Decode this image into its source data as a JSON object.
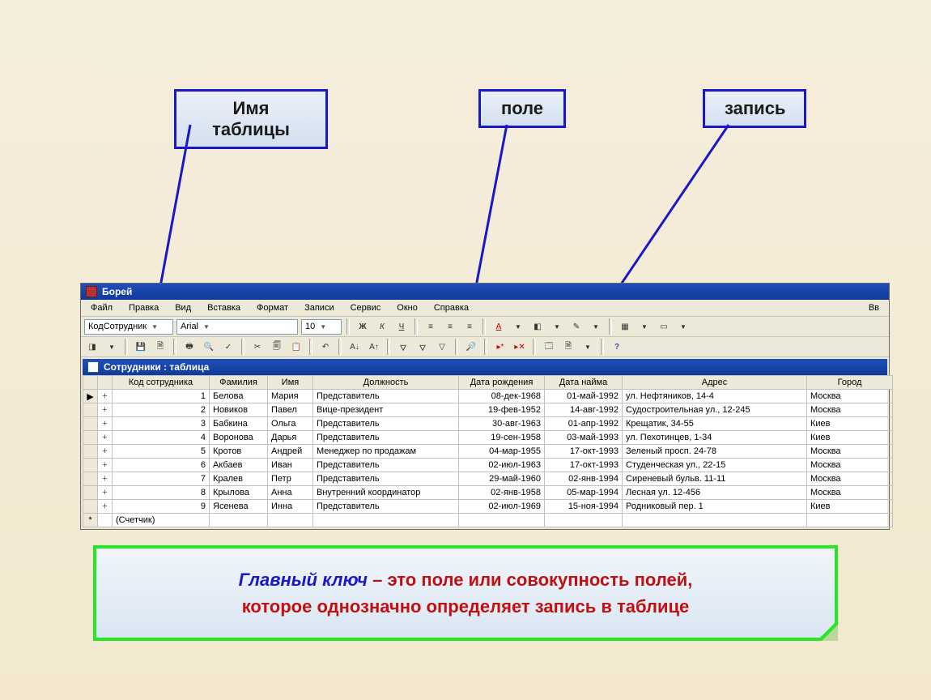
{
  "annotations": {
    "table_name": "Имя таблицы",
    "field": "поле",
    "record": "запись"
  },
  "app": {
    "title": "Борей",
    "menu": [
      "Файл",
      "Правка",
      "Вид",
      "Вставка",
      "Формат",
      "Записи",
      "Сервис",
      "Окно",
      "Справка"
    ],
    "menu_right": "Вв",
    "font_field": "КодСотрудник",
    "font_name": "Arial",
    "font_size": "10",
    "sub_title": "Сотрудники : таблица"
  },
  "toolbar2": {
    "bold": "Ж",
    "italic": "К",
    "underline": "Ч"
  },
  "columns": [
    "Код сотрудника",
    "Фамилия",
    "Имя",
    "Должность",
    "Дата рождения",
    "Дата найма",
    "Адрес",
    "Город"
  ],
  "rows": [
    {
      "id": "1",
      "fam": "Белова",
      "name": "Мария",
      "role": "Представитель",
      "dob": "08-дек-1968",
      "hire": "01-май-1992",
      "addr": "ул. Нефтяников, 14-4",
      "city": "Москва",
      "sel": "▶"
    },
    {
      "id": "2",
      "fam": "Новиков",
      "name": "Павел",
      "role": "Вице-президент",
      "dob": "19-фев-1952",
      "hire": "14-авг-1992",
      "addr": "Судостроительная ул., 12-245",
      "city": "Москва",
      "sel": ""
    },
    {
      "id": "3",
      "fam": "Бабкина",
      "name": "Ольга",
      "role": "Представитель",
      "dob": "30-авг-1963",
      "hire": "01-апр-1992",
      "addr": "Крещатик, 34-55",
      "city": "Киев",
      "sel": ""
    },
    {
      "id": "4",
      "fam": "Воронова",
      "name": "Дарья",
      "role": "Представитель",
      "dob": "19-сен-1958",
      "hire": "03-май-1993",
      "addr": "ул. Пехотинцев, 1-34",
      "city": "Киев",
      "sel": ""
    },
    {
      "id": "5",
      "fam": "Кротов",
      "name": "Андрей",
      "role": "Менеджер по продажам",
      "dob": "04-мар-1955",
      "hire": "17-окт-1993",
      "addr": "Зеленый просп. 24-78",
      "city": "Москва",
      "sel": ""
    },
    {
      "id": "6",
      "fam": "Акбаев",
      "name": "Иван",
      "role": "Представитель",
      "dob": "02-июл-1963",
      "hire": "17-окт-1993",
      "addr": "Студенческая ул., 22-15",
      "city": "Москва",
      "sel": ""
    },
    {
      "id": "7",
      "fam": "Кралев",
      "name": "Петр",
      "role": "Представитель",
      "dob": "29-май-1960",
      "hire": "02-янв-1994",
      "addr": "Сиреневый бульв. 11-11",
      "city": "Москва",
      "sel": ""
    },
    {
      "id": "8",
      "fam": "Крылова",
      "name": "Анна",
      "role": "Внутренний координатор",
      "dob": "02-янв-1958",
      "hire": "05-мар-1994",
      "addr": "Лесная ул. 12-456",
      "city": "Москва",
      "sel": ""
    },
    {
      "id": "9",
      "fam": "Ясенева",
      "name": "Инна",
      "role": "Представитель",
      "dob": "02-июл-1969",
      "hire": "15-ноя-1994",
      "addr": "Родниковый пер. 1",
      "city": "Киев",
      "sel": ""
    }
  ],
  "new_row_placeholder": "(Счетчик)",
  "definition": {
    "title": "Главный ключ",
    "dash": " – ",
    "text1": "это поле или совокупность полей,",
    "text2": "которое  однозначно  определяет  запись  в таблице"
  }
}
